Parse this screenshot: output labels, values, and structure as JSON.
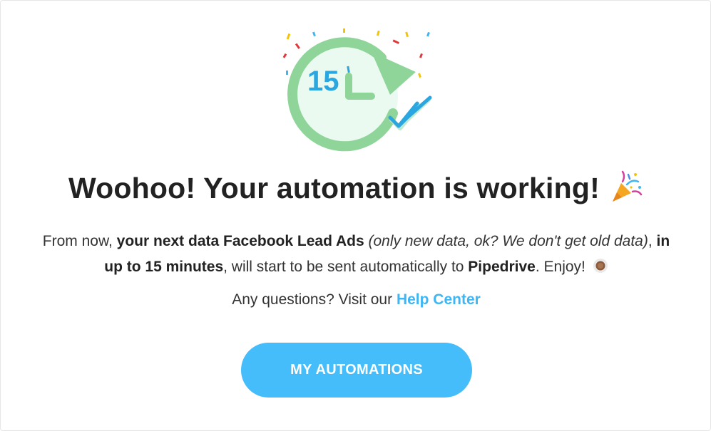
{
  "modal": {
    "clock_number": "15",
    "title": "Woohoo! Your automation is working!",
    "description": {
      "p1": "From now, ",
      "b1": "your next data Facebook Lead Ads",
      "p2": " ",
      "i1": "(only new data, ok? We don't get old data)",
      "p3": ", ",
      "b2": "in up to 15 minutes",
      "p4": ", will start to be sent automatically to ",
      "b3": "Pipedrive",
      "p5": ". Enjoy! "
    },
    "help": {
      "prefix": "Any questions? Visit our ",
      "link_label": "Help Center"
    },
    "button_label": "MY AUTOMATIONS"
  },
  "colors": {
    "accent": "#45bdfb",
    "link": "#3fb6f4",
    "clock_green": "#8fd59a",
    "clock_fill": "#eafaf0",
    "clock_blue": "#2aa6e0"
  },
  "icons": {
    "illustration": "clock-refresh-check-icon",
    "title_emoji": "party-popper-icon",
    "description_emoji": "coffee-cup-icon"
  }
}
